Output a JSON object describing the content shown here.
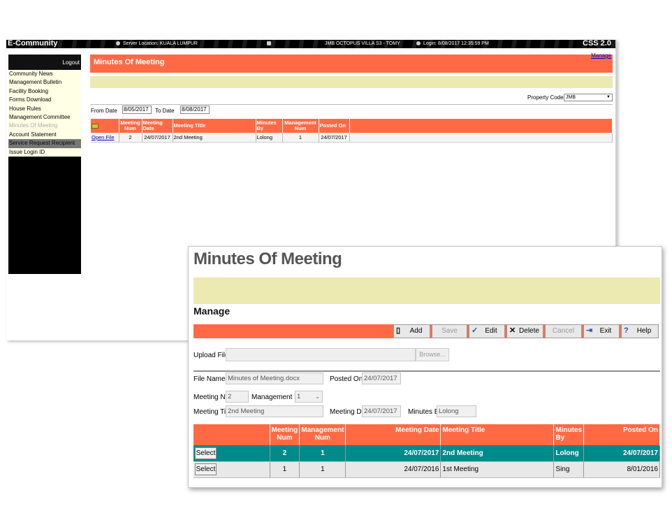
{
  "back": {
    "app_title": "E-Community",
    "server_location": "Server Location: KUALA LUMPUR",
    "property": "JMB OCTOPUS VILLA S3 - TOMY",
    "login": "Login: 8/08/2017 12:35:59 PM",
    "product": "CSS 2.0",
    "logout": "Logout",
    "menu": [
      "Community News",
      "Management Bulletin",
      "Facility Booking",
      "Forms Download",
      "House Rules",
      "Management Committee",
      "Minutes Of Meeting",
      "Account Statement",
      "Service Request Recipient",
      "Issue Login ID"
    ],
    "header_title": "Minutes Of Meeting",
    "manage_link": "Manage",
    "property_code_label": "Property Code",
    "property_code_value": "JMB",
    "from_date_label": "From Date",
    "from_date_value": "8/05/2017",
    "to_date_label": "To Date",
    "to_date_value": "8/08/2017",
    "table": {
      "headers": [
        "Meeting Num",
        "Meeting Date",
        "Meeting Title",
        "Minutes By",
        "Management Num",
        "Posted On"
      ],
      "row": {
        "link": "Open File",
        "meeting_num": "2",
        "meeting_date": "24/07/2017",
        "meeting_title": "2nd Meeting",
        "minutes_by": "Lolong",
        "management_num": "1",
        "posted_on": "24/07/2017"
      }
    }
  },
  "front": {
    "title": "Minutes Of Meeting",
    "manage_heading": "Manage",
    "toolbar": {
      "add": "Add",
      "save": "Save",
      "edit": "Edit",
      "delete": "Delete",
      "cancel": "Cancel",
      "exit": "Exit",
      "help": "Help"
    },
    "upload_label": "Upload File",
    "browse": "Browse...",
    "file_name_label": "File Name",
    "file_name_value": "Minutes of Meeting.docx",
    "posted_on_label": "Posted On",
    "posted_on_value": "24/07/2017",
    "meeting_num_label": "Meeting Num",
    "meeting_num_value": "2",
    "management_num_label": "Management Num",
    "management_num_value": "1",
    "meeting_title_label": "Meeting Title",
    "meeting_title_value": "2nd Meeting",
    "meeting_date_label": "Meeting Date",
    "meeting_date_value": "24/07/2017",
    "minutes_by_label": "Minutes By",
    "minutes_by_value": "Lolong",
    "table": {
      "headers": {
        "meeting_num": "Meeting Num",
        "management_num": "Management Num",
        "meeting_date": "Meeting Date",
        "meeting_title": "Meeting Title",
        "minutes_by": "Minutes By",
        "posted_on": "Posted On"
      },
      "select_label": "Select",
      "rows": [
        {
          "meeting_num": "2",
          "management_num": "1",
          "meeting_date": "24/07/2017",
          "meeting_title": "2nd Meeting",
          "minutes_by": "Lolong",
          "posted_on": "24/07/2017"
        },
        {
          "meeting_num": "1",
          "management_num": "1",
          "meeting_date": "24/07/2016",
          "meeting_title": "1st Meeting",
          "minutes_by": "Sing",
          "posted_on": "8/01/2016"
        }
      ]
    }
  }
}
